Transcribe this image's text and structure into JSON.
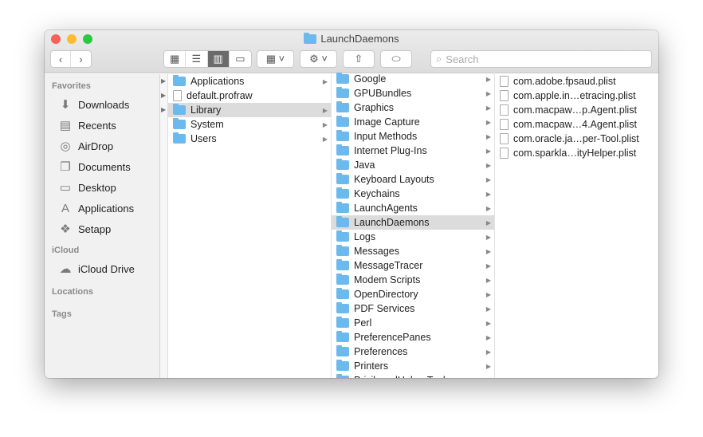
{
  "window": {
    "title": "LaunchDaemons"
  },
  "toolbar": {
    "search_placeholder": "Search",
    "icons": [
      "back",
      "forward",
      "icon-view",
      "list-view",
      "column-view",
      "gallery-view",
      "group",
      "action-gear",
      "share",
      "tag"
    ]
  },
  "sidebar": {
    "favorites_header": "Favorites",
    "favorites": [
      {
        "label": "Downloads",
        "icon": "⬇"
      },
      {
        "label": "Recents",
        "icon": "▤"
      },
      {
        "label": "AirDrop",
        "icon": "◎"
      },
      {
        "label": "Documents",
        "icon": "❐"
      },
      {
        "label": "Desktop",
        "icon": "▭"
      },
      {
        "label": "Applications",
        "icon": "A"
      },
      {
        "label": "Setapp",
        "icon": "❖"
      }
    ],
    "icloud_header": "iCloud",
    "icloud": [
      {
        "label": "iCloud Drive",
        "icon": "☁"
      }
    ],
    "locations_header": "Locations",
    "tags_header": "Tags"
  },
  "columns": {
    "col1": [
      {
        "name": "Applications",
        "type": "folder",
        "arrow": true
      },
      {
        "name": "default.profraw",
        "type": "file",
        "arrow": false
      },
      {
        "name": "Library",
        "type": "folder",
        "arrow": true,
        "selected": true
      },
      {
        "name": "System",
        "type": "folder",
        "arrow": true
      },
      {
        "name": "Users",
        "type": "folder",
        "arrow": true
      }
    ],
    "col2": [
      "Google",
      "GPUBundles",
      "Graphics",
      "Image Capture",
      "Input Methods",
      "Internet Plug-Ins",
      "Java",
      "Keyboard Layouts",
      "Keychains",
      "LaunchAgents",
      "LaunchDaemons",
      "Logs",
      "Messages",
      "MessageTracer",
      "Modem Scripts",
      "OpenDirectory",
      "PDF Services",
      "Perl",
      "PreferencePanes",
      "Preferences",
      "Printers",
      "PrivilegedHelperTools"
    ],
    "col2_selected": "LaunchDaemons",
    "col3": [
      "com.adobe.fpsaud.plist",
      "com.apple.in…etracing.plist",
      "com.macpaw…p.Agent.plist",
      "com.macpaw…4.Agent.plist",
      "com.oracle.ja…per-Tool.plist",
      "com.sparkla…ityHelper.plist"
    ]
  },
  "colors": {
    "folder": "#6cb9ee",
    "selection": "#dcdcdc",
    "close": "#fc5f57",
    "minimize": "#fdbc2e",
    "zoom": "#28c840"
  }
}
